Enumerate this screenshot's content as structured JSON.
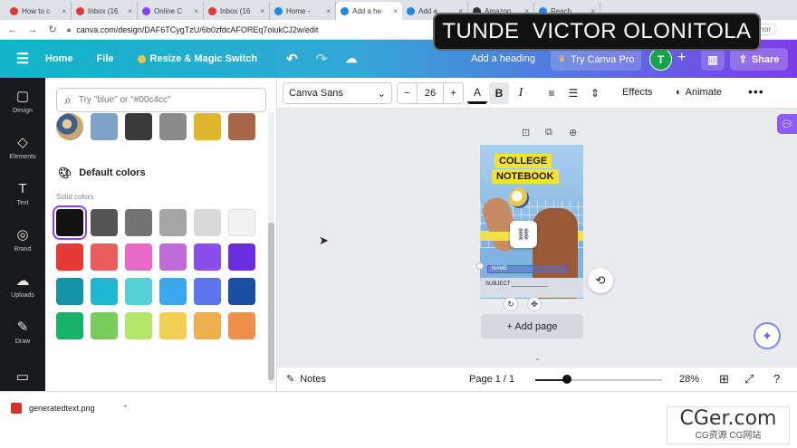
{
  "browser": {
    "tabs": [
      {
        "label": "How to c",
        "color": "#e53935"
      },
      {
        "label": "Inbox (16",
        "color": "#e53935"
      },
      {
        "label": "Online C",
        "color": "#8b3dff"
      },
      {
        "label": "Inbox (16",
        "color": "#e53935"
      },
      {
        "label": "Home -",
        "color": "#1e88e5"
      },
      {
        "label": "Add a he",
        "color": "#1e88e5"
      },
      {
        "label": "Add a",
        "color": "#1e88e5"
      },
      {
        "label": "Amazon",
        "color": "#333333"
      },
      {
        "label": "Reach",
        "color": "#1e88e5"
      }
    ],
    "url": "canva.com/design/DAF6TCygTzU/6b0zfdcAFOREq7oiukCJ2w/edit",
    "error_label": "Error"
  },
  "banner": {
    "text": "TUNDE  VICTOR OLONITOLA"
  },
  "header": {
    "home": "Home",
    "file": "File",
    "resize": "Resize & Magic Switch",
    "add_heading": "Add a heading",
    "try_pro": "Try Canva Pro",
    "avatar_letter": "T",
    "share": "Share"
  },
  "rail": [
    {
      "label": "Design",
      "icon": "▢"
    },
    {
      "label": "Elements",
      "icon": "◇"
    },
    {
      "label": "Text",
      "icon": "T"
    },
    {
      "label": "Brand",
      "icon": "◎"
    },
    {
      "label": "Uploads",
      "icon": "☁"
    },
    {
      "label": "Draw",
      "icon": "✎"
    },
    {
      "label": "",
      "icon": "▭"
    }
  ],
  "panel": {
    "search_placeholder": "Try \"blue\" or \"#00c4cc\"",
    "doc_colors": [
      "#7fa3c8",
      "#3a3a3a",
      "#8a8a8a",
      "#e0b72c",
      "#a86748"
    ],
    "default_title": "Default colors",
    "solid_label": "Solid colors",
    "solid_colors": [
      "#111111",
      "#545454",
      "#737373",
      "#a6a6a6",
      "#d9d9d9",
      "#f2f2f2",
      "#e53935",
      "#ec5c5c",
      "#e86ac4",
      "#c16ad9",
      "#8b4fe8",
      "#6a2ee0",
      "#1493a8",
      "#1fb8d3",
      "#56d1d6",
      "#3aa7ef",
      "#5b76ec",
      "#1b4fa3",
      "#18b26b",
      "#78cc5a",
      "#b4e66a",
      "#f0cf52",
      "#eeb04c",
      "#ef8f4a"
    ]
  },
  "toolbar": {
    "font": "Canva Sans",
    "size": "26",
    "minus": "−",
    "plus": "+",
    "effects": "Effects",
    "animate": "Animate"
  },
  "design": {
    "title_line1": "COLLEGE",
    "title_line2": "NOTEBOOK",
    "name_label": "NAME",
    "subject_label": "SUBJECT ____________"
  },
  "canvas": {
    "add_page": "+ Add page"
  },
  "bottom": {
    "notes": "Notes",
    "page": "Page 1 / 1",
    "zoom": "28%",
    "zoom_value": 28
  },
  "downloads": {
    "file": "generatedtext.png"
  },
  "watermark": {
    "line1": "CGer.com",
    "line2": "CG资源  CG网站"
  }
}
